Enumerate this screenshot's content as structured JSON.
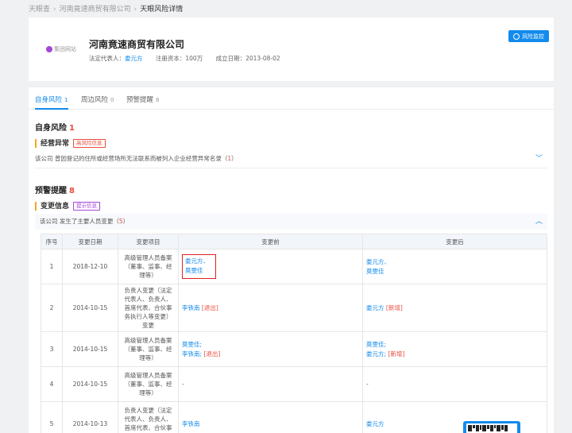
{
  "breadcrumb": {
    "items": [
      "天眼查",
      "河南竟速商贸有限公司",
      "天眼风险详情"
    ]
  },
  "company": {
    "logo_label": "集团网站",
    "name": "河南竟速商贸有限公司",
    "legal_rep_label": "法定代表人：",
    "legal_rep": "娄元方",
    "capital": "注册资本：100万",
    "founded": "成立日期：2013-08-02",
    "monitor_label": "风险监控"
  },
  "tabs": [
    {
      "label": "自身风险",
      "count": "1"
    },
    {
      "label": "周边风险",
      "count": "0"
    },
    {
      "label": "预警提醒",
      "count": "8"
    }
  ],
  "self_risk": {
    "title": "自身风险",
    "count": "1",
    "sub_title": "经营异常",
    "tag": "高风险信息",
    "summary_prefix": "该公司 曾因登记的住所或经营场所无法联系而被列入企业经营异常名录（",
    "summary_count": "1",
    "summary_suffix": "）"
  },
  "warning": {
    "title": "预警提醒",
    "count": "8",
    "sub_title": "变更信息",
    "tag": "提示信息",
    "summary_prefix": "该公司 发生了主要人员变更（",
    "summary_count": "5",
    "summary_suffix": "）"
  },
  "table": {
    "headers": [
      "序号",
      "变更日期",
      "变更项目",
      "变更前",
      "变更后"
    ],
    "rows": [
      {
        "no": "1",
        "date": "2018-12-10",
        "item": "高级管理人员备案（董事、监事、经理等）",
        "before_1": "娄元方、",
        "before_2": "莫雯佳",
        "after_1": "娄元方、",
        "after_2": "莫雯佳"
      },
      {
        "no": "2",
        "date": "2014-10-15",
        "item": "负责人变更（法定代表人、负责人、首席代表、合伙事务执行人等变更）变更",
        "before_name": "李铁南",
        "before_tag": "[退出]",
        "after_name": "娄元方",
        "after_tag": "[新增]"
      },
      {
        "no": "3",
        "date": "2014-10-15",
        "item": "高级管理人员备案（董事、监事、经理等）",
        "before_1": "莫雯佳;",
        "before_2_name": "李铁南;",
        "before_2_tag": "[退出]",
        "after_1": "莫雯佳;",
        "after_2_name": "娄元方;",
        "after_2_tag": "[新增]"
      },
      {
        "no": "4",
        "date": "2014-10-15",
        "item": "高级管理人员备案（董事、监事、经理等）",
        "before": "-",
        "after": "-"
      },
      {
        "no": "5",
        "date": "2014-10-13",
        "item": "负责人变更（法定代表人、负责人、首席代表、合伙事务执行人等变更）",
        "before_name": "李铁南",
        "after_name": "娄元方"
      }
    ]
  }
}
